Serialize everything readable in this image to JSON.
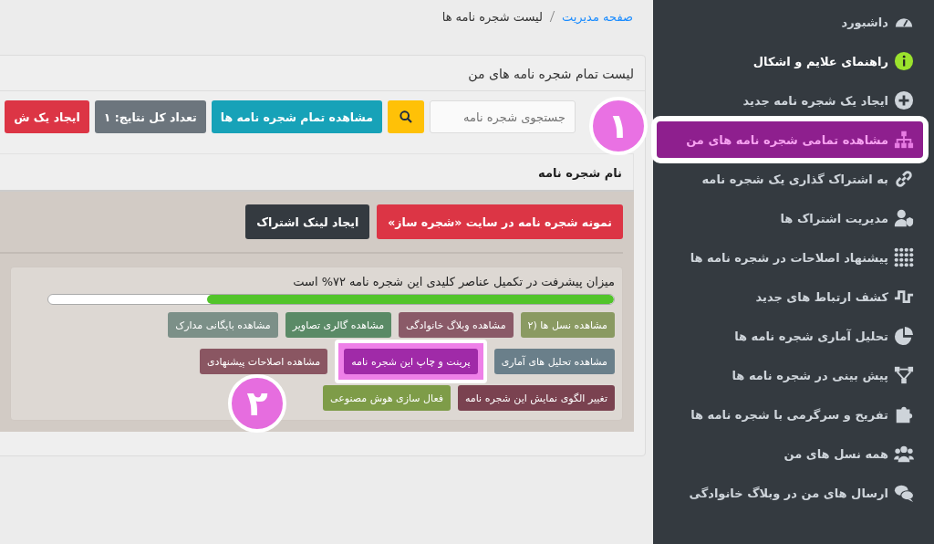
{
  "breadcrumb": [
    {
      "label": "صفحه مدیریت",
      "kind": "link"
    },
    {
      "label": "لیست شجره نامه ها",
      "kind": "current"
    }
  ],
  "card": {
    "title": "لیست تمام شجره نامه های من",
    "search": {
      "placeholder": "جستجوی شجره نامه"
    },
    "toolbar": [
      {
        "label": "مشاهده تمام شجره نامه ها",
        "color": "#17a2b8"
      },
      {
        "label": "تعداد کل نتایج: ۱",
        "color": "#6c757d"
      },
      {
        "label": "ایجاد یک ش",
        "color": "#dc3545"
      }
    ],
    "table": {
      "columns": [
        "نام شجره نامه"
      ],
      "row": {
        "actions": [
          {
            "label": "نمونه شجره نامه در سایت «شجره ساز»",
            "color": "#dc3545"
          },
          {
            "label": "ایجاد لینک اشتراک",
            "color": "#343a40"
          }
        ],
        "progress": {
          "text": "میزان پیشرفت در تکمیل عناصر کلیدی این شجره نامه ۷۲% است",
          "level": 0.72
        },
        "button_rows": [
          [
            {
              "label": "مشاهده نسل ها (۲",
              "color": "#8a9a62",
              "highlighted": false
            },
            {
              "label": "مشاهده وبلاگ خانوادگی",
              "color": "#8a5a68",
              "highlighted": false
            },
            {
              "label": "مشاهده گالری تصاویر",
              "color": "#5a8a66",
              "highlighted": false
            },
            {
              "label": "مشاهده بایگانی مدارک",
              "color": "#7c9088",
              "highlighted": false
            }
          ],
          [
            {
              "label": "مشاهده تحلیل های آماری",
              "color": "#6a7f8a",
              "highlighted": false
            },
            {
              "label": "پرینت و چاپ این شجره نامه",
              "color": "#a02aa8",
              "highlighted": true
            },
            {
              "label": "مشاهده اصلاحات پیشنهادی",
              "color": "#8a5662",
              "highlighted": false
            }
          ],
          [
            {
              "label": "تغییر الگوی نمایش این شجره نامه",
              "color": "#7a4250",
              "highlighted": false
            },
            {
              "label": "فعال سازی هوش مصنوعی",
              "color": "#7e9c48",
              "highlighted": false
            }
          ]
        ]
      }
    }
  },
  "sidebar": {
    "items": [
      {
        "label": "داشبورد",
        "kind": "gauge",
        "selected": false,
        "emphasized": false
      },
      {
        "label": "راهنمای علایم و اشکال",
        "kind": "info",
        "selected": false,
        "emphasized": true
      },
      {
        "label": "ایجاد یک شجره نامه جدید",
        "kind": "plus",
        "selected": false,
        "emphasized": false
      },
      {
        "label": "مشاهده تمامی شجره نامه های من",
        "kind": "sitemap",
        "selected": true,
        "emphasized": false
      },
      {
        "label": "به اشتراک گذاری یک شجره نامه",
        "kind": "link",
        "selected": false,
        "emphasized": false
      },
      {
        "label": "مدیریت اشتراک ها",
        "kind": "usershield",
        "selected": false,
        "emphasized": false
      },
      {
        "label": "پیشنهاد اصلاحات در شجره نامه ها",
        "kind": "dots",
        "selected": false,
        "emphasized": false
      },
      {
        "label": "کشف ارتباط های جدید",
        "kind": "wave",
        "selected": false,
        "emphasized": false
      },
      {
        "label": "تحلیل آماری شجره نامه ها",
        "kind": "pie",
        "selected": false,
        "emphasized": false
      },
      {
        "label": "پیش بینی در شجره نامه ها",
        "kind": "nodes",
        "selected": false,
        "emphasized": false
      },
      {
        "label": "تفریح و سرگرمی با شجره نامه ها",
        "kind": "puzzle",
        "selected": false,
        "emphasized": false
      },
      {
        "label": "همه نسل های من",
        "kind": "users",
        "selected": false,
        "emphasized": false
      },
      {
        "label": "ارسال های من در وبلاگ خانوادگی",
        "kind": "comments",
        "selected": false,
        "emphasized": false
      }
    ]
  },
  "annotations": [
    {
      "label": "۱"
    },
    {
      "label": "۲"
    }
  ]
}
